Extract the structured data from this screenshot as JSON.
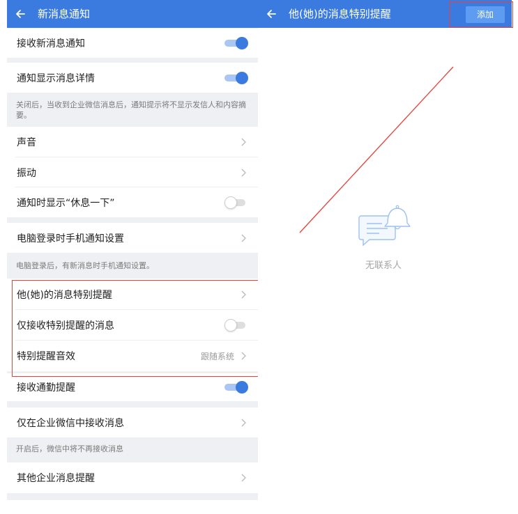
{
  "left": {
    "title": "新消息通知",
    "items": [
      {
        "label": "接收新消息通知",
        "toggle": true
      },
      {
        "label": "通知显示消息详情",
        "toggle": true
      },
      {
        "note": "关闭后，当收到企业微信消息后，通知提示将不显示发信人和内容摘要。"
      },
      {
        "label": "声音"
      },
      {
        "label": "振动"
      },
      {
        "label": "通知时显示“休息一下”",
        "toggle": false
      },
      {
        "label": "电脑登录时手机通知设置"
      },
      {
        "note": "电脑登录后，有新消息时手机通知设置。"
      },
      {
        "label": "他(她)的消息特别提醒"
      },
      {
        "label": "仅接收特别提醒的消息",
        "toggle": false
      },
      {
        "label": "特别提醒音效",
        "value": "跟随系统"
      },
      {
        "label": "接收通勤提醒",
        "toggle": true
      },
      {
        "label": "仅在企业微信中接收消息"
      },
      {
        "note": "开启后，微信中将不再接收消息"
      },
      {
        "label": "其他企业消息提醒"
      }
    ]
  },
  "right": {
    "title": "他(她)的消息特别提醒",
    "add_label": "添加",
    "empty_text": "无联系人"
  },
  "colors": {
    "header_blue": "#3b7be0",
    "add_button": "#5d9cf0",
    "toggle_on": "#3b7be0",
    "page_gray": "#eff0f3",
    "highlight_red": "#e8403a"
  },
  "icons": {
    "back": "arrow-left-icon",
    "chevron": "chevron-right-icon",
    "empty": "chat-bubble-bell-icon"
  }
}
